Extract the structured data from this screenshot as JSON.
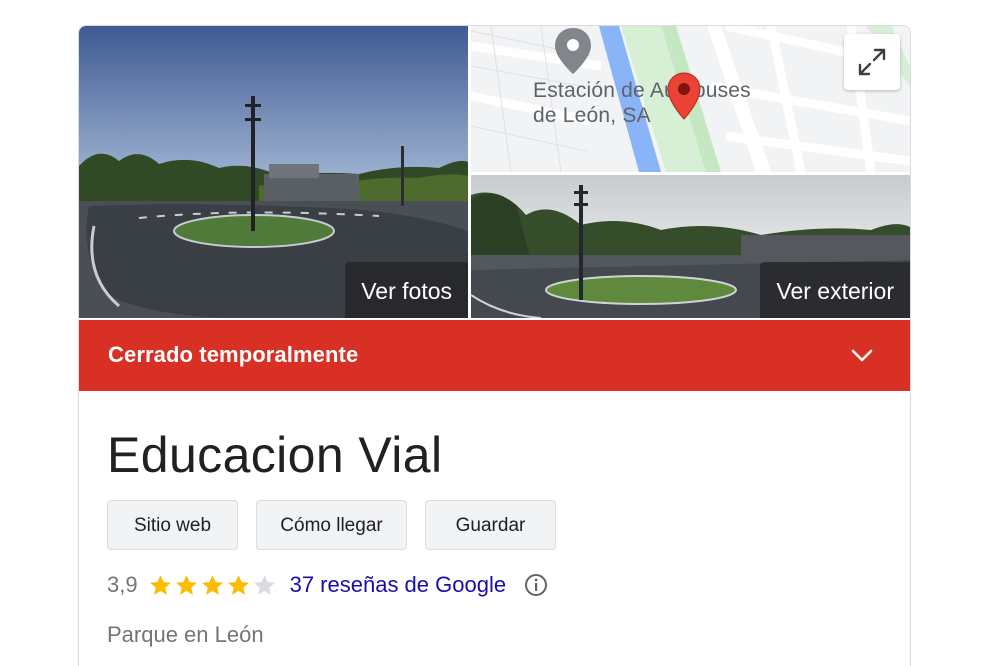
{
  "photos": {
    "main_button": "Ver fotos",
    "street_button": "Ver exterior"
  },
  "map": {
    "label_line1": "Estación de Autobuses",
    "label_line2": "de León, SA"
  },
  "status": {
    "text": "Cerrado temporalmente",
    "color": "#d93025"
  },
  "place": {
    "name": "Educacion Vial",
    "category": "Parque en León"
  },
  "actions": [
    {
      "label": "Sitio web"
    },
    {
      "label": "Cómo llegar"
    },
    {
      "label": "Guardar"
    }
  ],
  "rating": {
    "value": "3,9",
    "stars": 3.9,
    "max_stars": 5,
    "reviews_text": "37 reseñas de Google",
    "star_color": "#fbbc04"
  },
  "colors": {
    "link": "#1a0dab",
    "accent_red": "#d93025"
  },
  "icons": {
    "expand": "expand-icon",
    "chevron": "chevron-down-icon",
    "info": "info-icon",
    "map_pin": "map-pin-icon"
  }
}
